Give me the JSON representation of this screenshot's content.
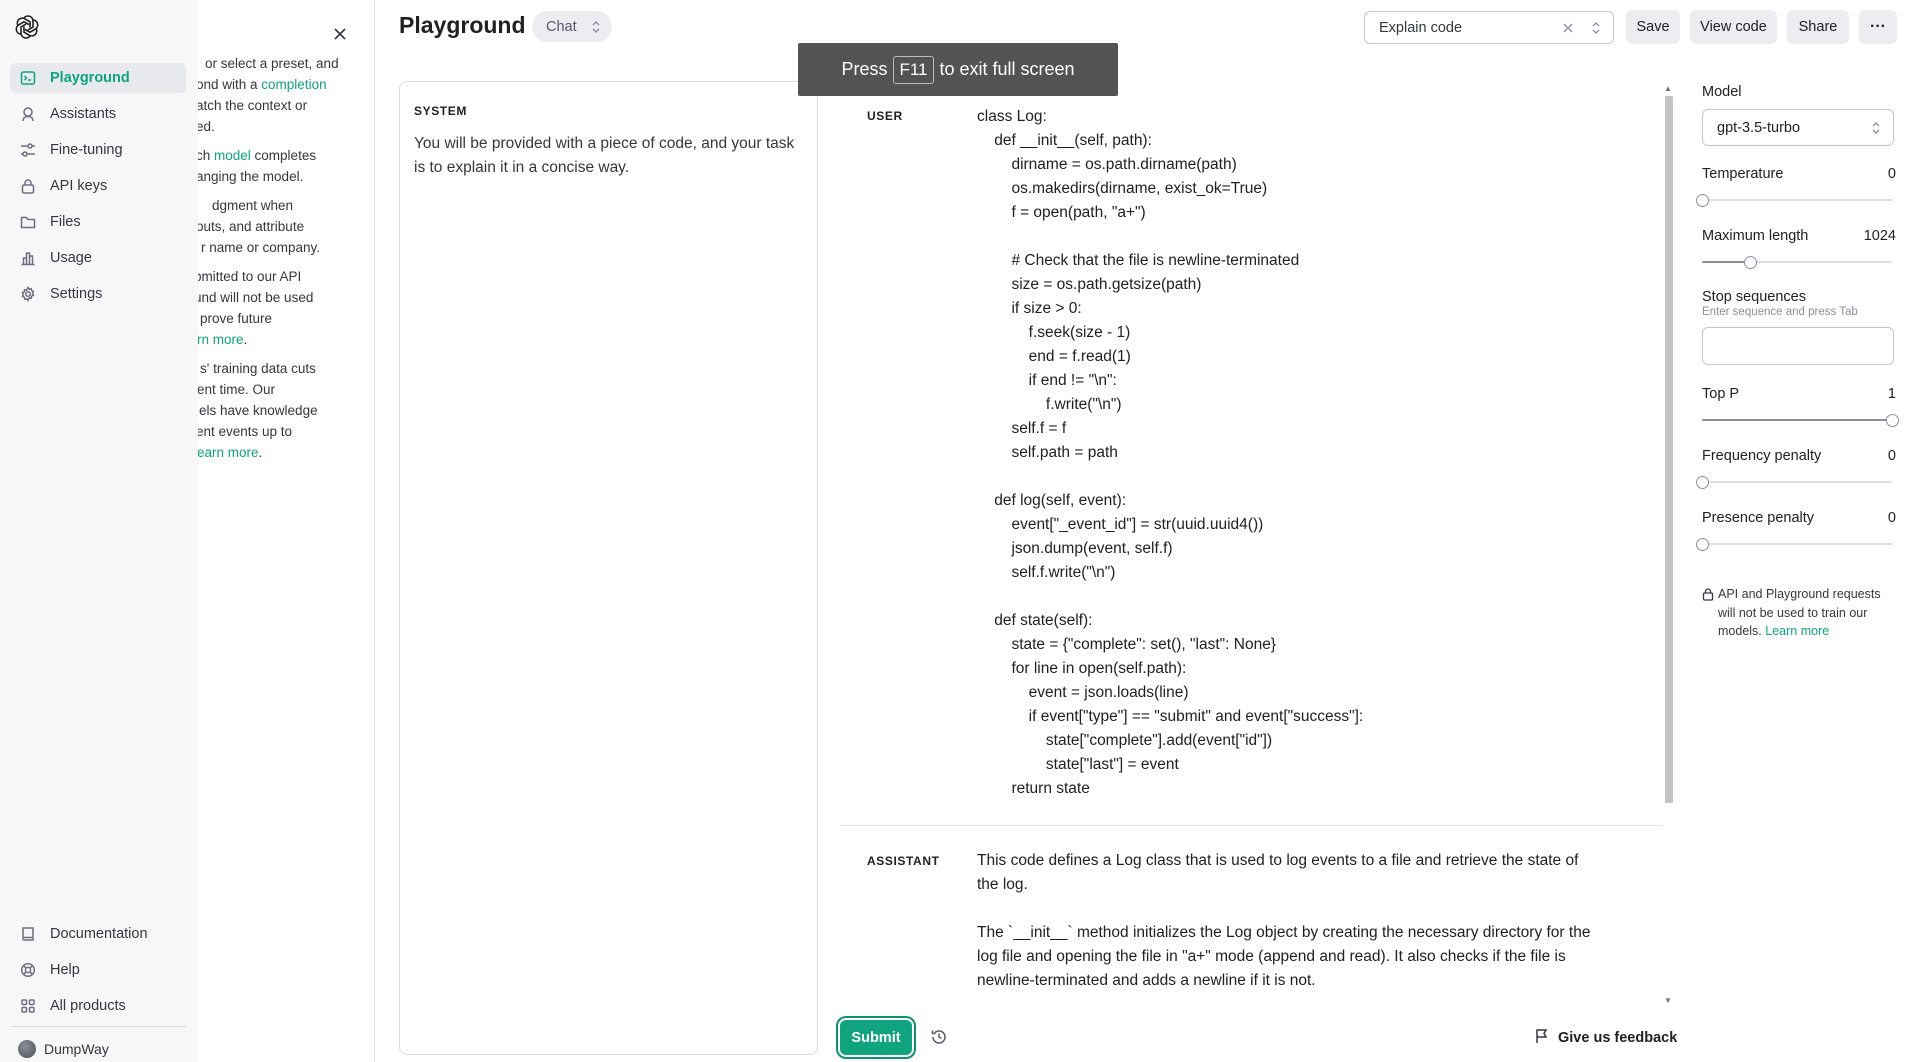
{
  "sidebar": {
    "items": [
      {
        "label": "Playground",
        "icon": "terminal-icon",
        "active": true
      },
      {
        "label": "Assistants",
        "icon": "robot-icon"
      },
      {
        "label": "Fine-tuning",
        "icon": "sliders-icon"
      },
      {
        "label": "API keys",
        "icon": "lock-icon"
      },
      {
        "label": "Files",
        "icon": "folder-icon"
      },
      {
        "label": "Usage",
        "icon": "bar-chart-icon"
      },
      {
        "label": "Settings",
        "icon": "gear-icon"
      }
    ],
    "bottom_items": [
      {
        "label": "Documentation",
        "icon": "book-icon"
      },
      {
        "label": "Help",
        "icon": "help-buoy-icon"
      },
      {
        "label": "All products",
        "icon": "grid-icon"
      }
    ],
    "user_name": "DumpWay"
  },
  "help_panel": {
    "lines": [
      {
        "pre": "or select a preset, and",
        "link": "",
        "post": ""
      },
      {
        "pre": "ond with a ",
        "link": "completion",
        "post": ""
      },
      {
        "pre": "atch the context or",
        "link": "",
        "post": ""
      },
      {
        "pre": "ed.",
        "link": "",
        "post": ""
      },
      {
        "pre": "ch ",
        "link": "model",
        "post": " completes"
      },
      {
        "pre": "anging the model.",
        "link": "",
        "post": ""
      },
      {
        "pre": "dgment when",
        "link": "",
        "post": ""
      },
      {
        "pre": "outs, and attribute",
        "link": "",
        "post": ""
      },
      {
        "pre": "r name or company.",
        "link": "",
        "post": ""
      },
      {
        "pre": "bmitted to our API",
        "link": "",
        "post": ""
      },
      {
        "pre": "und will not be used",
        "link": "",
        "post": ""
      },
      {
        "pre": "prove future",
        "link": "",
        "post": ""
      },
      {
        "pre": "",
        "link": "rn more",
        "post": "."
      },
      {
        "pre": "s' training data cuts",
        "link": "",
        "post": ""
      },
      {
        "pre": "ent time. Our",
        "link": "",
        "post": ""
      },
      {
        "pre": "els have knowledge",
        "link": "",
        "post": ""
      },
      {
        "pre": "ent events up to",
        "link": "",
        "post": ""
      },
      {
        "pre": "",
        "link": "earn more",
        "post": "."
      }
    ]
  },
  "header": {
    "title": "Playground",
    "mode": "Chat",
    "preset": "Explain code",
    "save_label": "Save",
    "view_code_label": "View code",
    "share_label": "Share",
    "more_label": "···"
  },
  "system": {
    "label": "SYSTEM",
    "text": "You will be provided with a piece of code, and your task is to explain it in a concise way."
  },
  "conversation": {
    "user_label": "USER",
    "user_code": "class Log:\n    def __init__(self, path):\n        dirname = os.path.dirname(path)\n        os.makedirs(dirname, exist_ok=True)\n        f = open(path, \"a+\")\n\n        # Check that the file is newline-terminated\n        size = os.path.getsize(path)\n        if size > 0:\n            f.seek(size - 1)\n            end = f.read(1)\n            if end != \"\\n\":\n                f.write(\"\\n\")\n        self.f = f\n        self.path = path\n\n    def log(self, event):\n        event[\"_event_id\"] = str(uuid.uuid4())\n        json.dump(event, self.f)\n        self.f.write(\"\\n\")\n\n    def state(self):\n        state = {\"complete\": set(), \"last\": None}\n        for line in open(self.path):\n            event = json.loads(line)\n            if event[\"type\"] == \"submit\" and event[\"success\"]:\n                state[\"complete\"].add(event[\"id\"])\n                state[\"last\"] = event\n        return state",
    "assistant_label": "ASSISTANT",
    "assistant_paragraphs": [
      "This code defines a Log class that is used to log events to a file and retrieve the state of the log.",
      "The `__init__` method initializes the Log object by creating the necessary directory for the log file and opening the file in \"a+\" mode (append and read). It also checks if the file is newline-terminated and adds a newline if it is not."
    ]
  },
  "footer": {
    "submit_label": "Submit",
    "feedback_label": "Give us feedback"
  },
  "settings": {
    "model_label": "Model",
    "model_value": "gpt-3.5-turbo",
    "temperature_label": "Temperature",
    "temperature_value": "0",
    "temperature_level": 0,
    "max_length_label": "Maximum length",
    "max_length_value": "1024",
    "max_length_level": 0.25,
    "stop_label": "Stop sequences",
    "stop_hint": "Enter sequence and press Tab",
    "top_p_label": "Top P",
    "top_p_value": "1",
    "top_p_level": 1,
    "freq_label": "Frequency penalty",
    "freq_value": "0",
    "freq_level": 0,
    "presence_label": "Presence penalty",
    "presence_value": "0",
    "presence_level": 0,
    "notice_text": "API and Playground requests will not be used to train our models.",
    "notice_link": "Learn more"
  },
  "toast": {
    "press": "Press",
    "key": "F11",
    "rest": "to exit full screen"
  },
  "colors": {
    "accent": "#10a37f",
    "sidebar_bg": "#f7f7f8",
    "toast_bg": "#464646"
  }
}
